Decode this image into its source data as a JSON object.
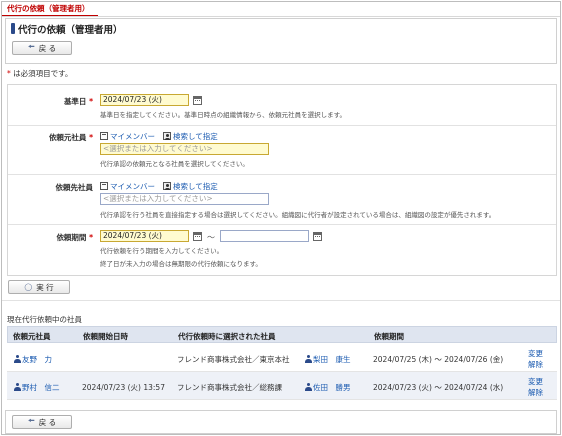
{
  "tab": {
    "label": "代行の依頼（管理者用）"
  },
  "page": {
    "title": "代行の依頼（管理者用）"
  },
  "toolbar": {
    "back_label": "戻 る",
    "back_icon": "left-arrow-icon"
  },
  "required_note": {
    "mark": "*",
    "text": " は必須項目です。"
  },
  "form": {
    "base_date": {
      "label": "基準日",
      "required_mark": "*",
      "value": "2024/07/23 (火)",
      "hint": "基準日を指定してください。基準日時点の組織情報から、依頼元社員を選択します。"
    },
    "requester": {
      "label": "依頼元社員",
      "required_mark": "*",
      "my_member_label": "マイメンバー",
      "search_label": "検索して指定",
      "placeholder": "<選択または入力してください>",
      "hint": "代行承認の依頼元となる社員を選択してください。"
    },
    "delegate": {
      "label": "依頼先社員",
      "my_member_label": "マイメンバー",
      "search_label": "検索して指定",
      "placeholder": "<選択または入力してください>",
      "hint": "代行承認を行う社員を直接指定する場合は選択してください。組織図に代行者が設定されている場合は、組織図の設定が優先されます。"
    },
    "period": {
      "label": "依頼期間",
      "required_mark": "*",
      "start_value": "2024/07/23 (火)",
      "separator": "〜",
      "end_value": "",
      "hint1": "代行依頼を行う期間を入力してください。",
      "hint2": "終了日が未入力の場合は無期限の代行依頼になります。"
    },
    "execute_label": "実 行"
  },
  "current": {
    "section_title": "現在代行依頼中の社員",
    "columns": [
      "依頼元社員",
      "依頼開始日時",
      "代行依頼時に選択された社員",
      "依頼期間"
    ],
    "rows": [
      {
        "requester": "友野　力",
        "start": "",
        "org": "フレンド商事株式会社／東京本社",
        "delegate": "梨田　康生",
        "period": "2024/07/25 (木) 〜 2024/07/26 (金)",
        "change": "変更",
        "cancel": "解除"
      },
      {
        "requester": "野村　信二",
        "start": "2024/07/23 (火) 13:57",
        "org": "フレンド商事株式会社／総務課",
        "delegate": "佐田　勝男",
        "period": "2024/07/23 (火) 〜 2024/07/24 (水)",
        "change": "変更",
        "cancel": "解除"
      }
    ]
  },
  "colors": {
    "accent": "#c00000",
    "link": "#1a5ab0",
    "required_bg": "#fffbd0",
    "header_bg": "#dfe5f0"
  }
}
